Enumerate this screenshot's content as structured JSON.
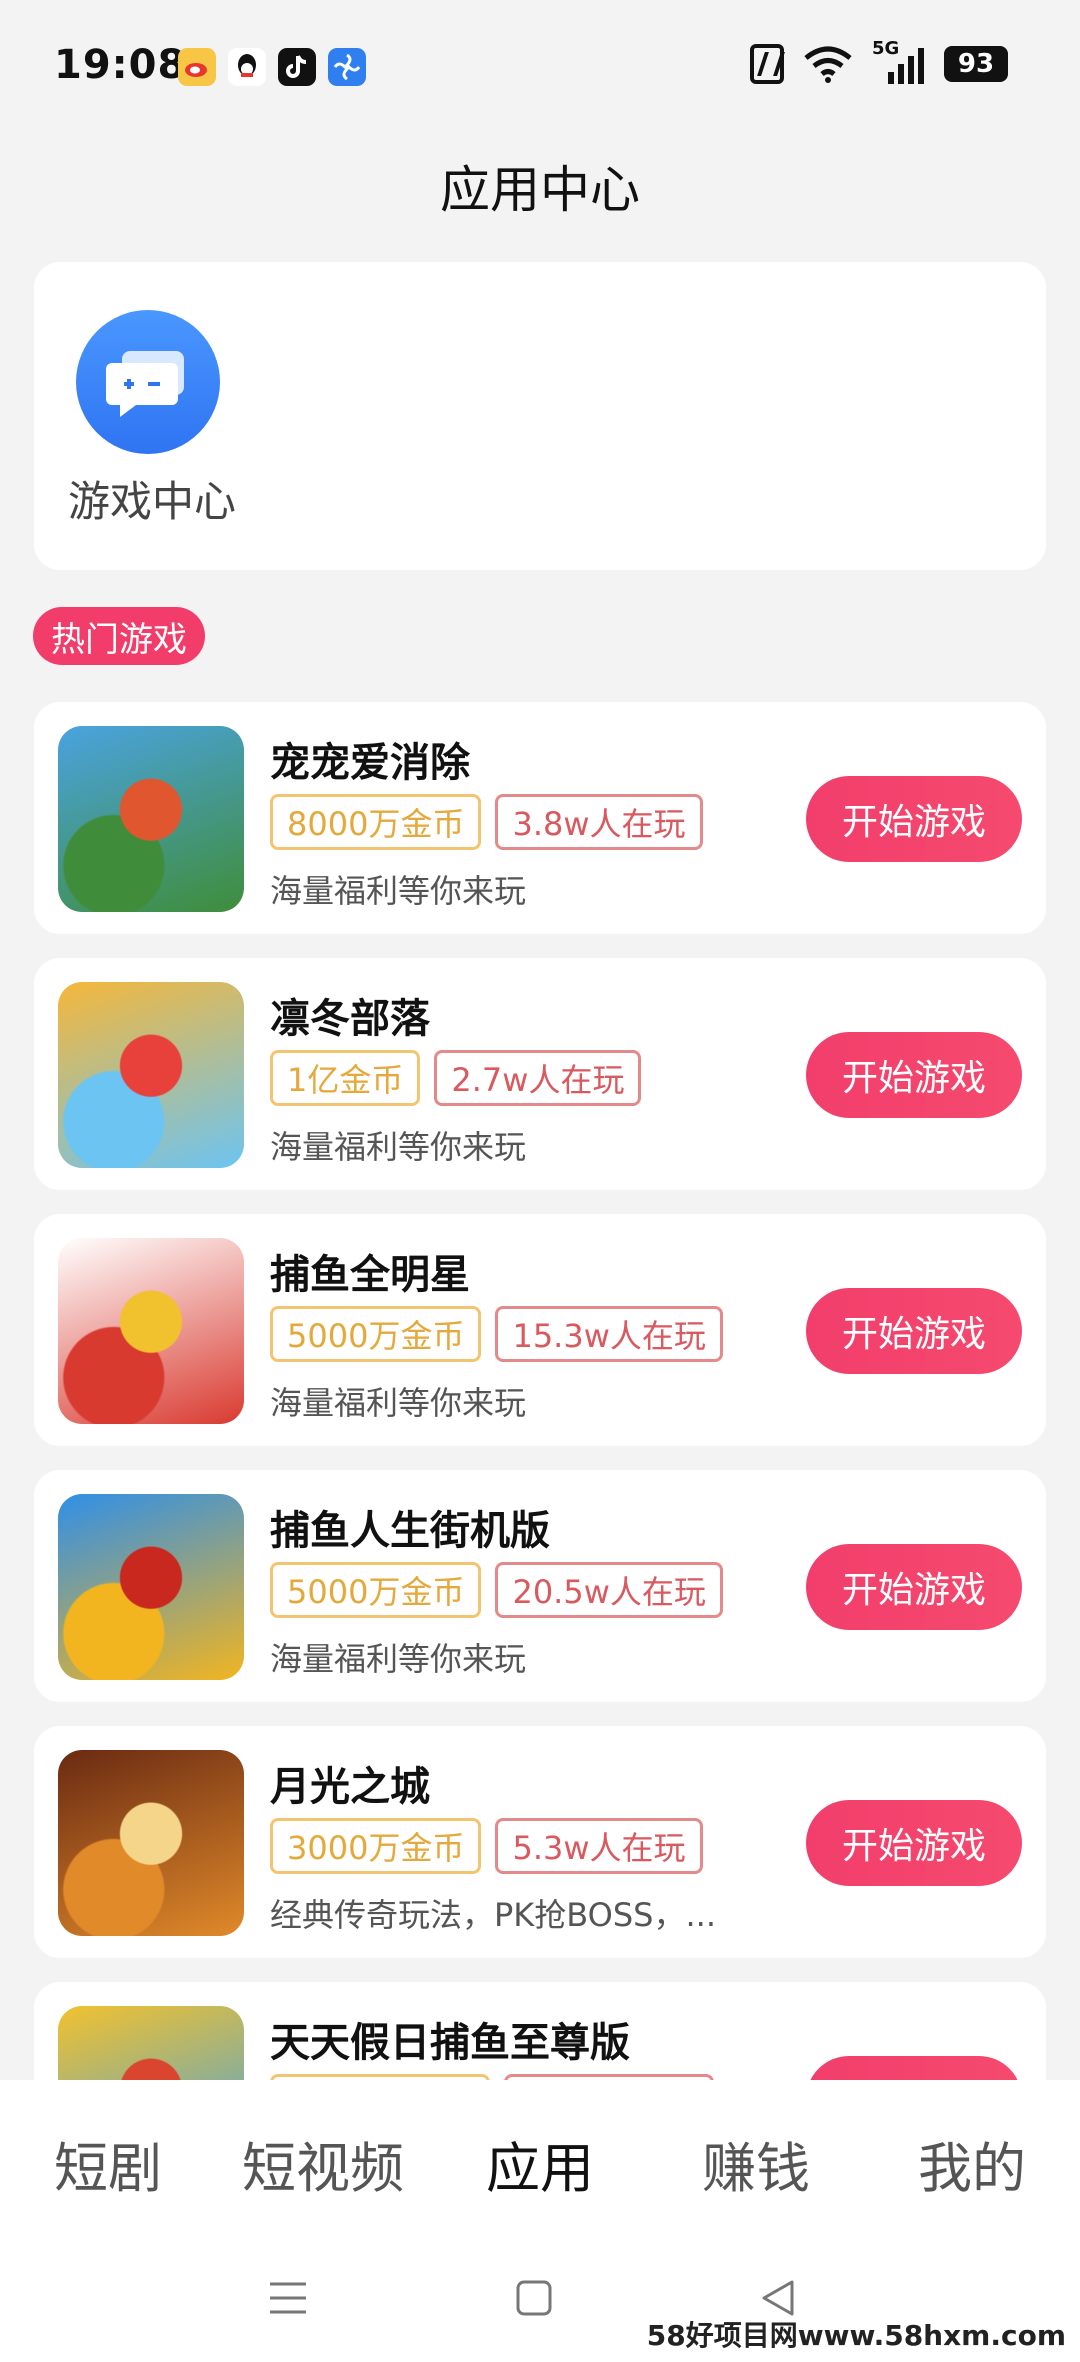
{
  "status_bar": {
    "time": "19:08",
    "app_icons": [
      "weibo-icon",
      "qq-icon",
      "tiktok-icon",
      "fan-app-icon"
    ],
    "network": "5G",
    "battery": "93"
  },
  "page_title": "应用中心",
  "feature": {
    "game_center_label": "游戏中心"
  },
  "section_tag": "热门游戏",
  "games": [
    {
      "name": "宠宠爱消除",
      "coins": "8000万金币",
      "players": "3.8w人在玩",
      "desc": "海量福利等你来玩",
      "button": "开始游戏",
      "icon_colors": [
        "#4aa3e0",
        "#3f8d3a",
        "#e0562f"
      ]
    },
    {
      "name": "凛冬部落",
      "coins": "1亿金币",
      "players": "2.7w人在玩",
      "desc": "海量福利等你来玩",
      "button": "开始游戏",
      "icon_colors": [
        "#f5b73a",
        "#6cc4f2",
        "#e8413c"
      ]
    },
    {
      "name": "捕鱼全明星",
      "coins": "5000万金币",
      "players": "15.3w人在玩",
      "desc": "海量福利等你来玩",
      "button": "开始游戏",
      "icon_colors": [
        "#ffffff",
        "#d93a30",
        "#f2c12e"
      ]
    },
    {
      "name": "捕鱼人生街机版",
      "coins": "5000万金币",
      "players": "20.5w人在玩",
      "desc": "海量福利等你来玩",
      "button": "开始游戏",
      "icon_colors": [
        "#2f8fe8",
        "#f2b520",
        "#c8281e"
      ]
    },
    {
      "name": "月光之城",
      "coins": "3000万金币",
      "players": "5.3w人在玩",
      "desc": "经典传奇玩法，PK抢BOSS，...",
      "button": "开始游戏",
      "icon_colors": [
        "#6a2a12",
        "#e08a2a",
        "#f5d58a"
      ]
    },
    {
      "name": "天天假日捕鱼至尊版",
      "coins": "",
      "players": "",
      "desc": "",
      "button": "",
      "icon_colors": [
        "#f2c12e",
        "#3aa0e8",
        "#d9452f"
      ]
    }
  ],
  "tabs": [
    {
      "label": "短剧",
      "active": false
    },
    {
      "label": "短视频",
      "active": false
    },
    {
      "label": "应用",
      "active": true
    },
    {
      "label": "赚钱",
      "active": false
    },
    {
      "label": "我的",
      "active": false
    }
  ],
  "system_nav": [
    "menu-icon",
    "home-icon",
    "back-icon"
  ],
  "watermark": "58好项目网www.58hxm.com",
  "colors": {
    "accent": "#f23d6a",
    "coin_badge": "#e5a83a",
    "players_badge": "#d9595f",
    "game_center_blue": "#3a84f5"
  }
}
